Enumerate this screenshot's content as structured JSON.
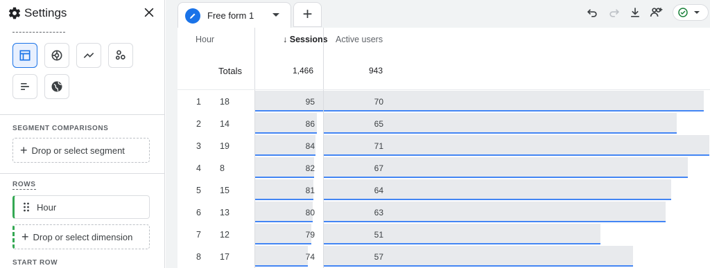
{
  "settings": {
    "title": "Settings",
    "viz_icons": [
      "table-icon",
      "donut-chart-icon",
      "line-chart-icon",
      "scatter-icon",
      "bar-chart-icon",
      "globe-icon"
    ],
    "segment_label": "SEGMENT COMPARISONS",
    "segment_drop": "Drop or select segment",
    "rows_label": "ROWS",
    "row_dimension": "Hour",
    "dimension_drop": "Drop or select dimension",
    "start_row_label": "START ROW"
  },
  "tabs": {
    "active_label": "Free form 1",
    "add_label": "+"
  },
  "table": {
    "headers": {
      "hour": "Hour",
      "sessions": "Sessions",
      "sort_arrow": "↓",
      "active_users": "Active users"
    },
    "totals": {
      "label": "Totals",
      "sessions": "1,466",
      "active_users": "943"
    },
    "max_sessions": 95,
    "max_active_users": 71,
    "rows": [
      {
        "index": "1",
        "hour": "18",
        "sessions": 95,
        "active_users": 70
      },
      {
        "index": "2",
        "hour": "14",
        "sessions": 86,
        "active_users": 65
      },
      {
        "index": "3",
        "hour": "19",
        "sessions": 84,
        "active_users": 71
      },
      {
        "index": "4",
        "hour": "8",
        "sessions": 82,
        "active_users": 67
      },
      {
        "index": "5",
        "hour": "15",
        "sessions": 81,
        "active_users": 64
      },
      {
        "index": "6",
        "hour": "13",
        "sessions": 80,
        "active_users": 63
      },
      {
        "index": "7",
        "hour": "12",
        "sessions": 79,
        "active_users": 51
      },
      {
        "index": "8",
        "hour": "17",
        "sessions": 74,
        "active_users": 57
      }
    ]
  },
  "colors": {
    "accent": "#1a73e8",
    "bar_line": "#4285f4",
    "bar_fill": "#e8eaed",
    "status_green": "#188038",
    "dimension_green": "#34a853"
  }
}
